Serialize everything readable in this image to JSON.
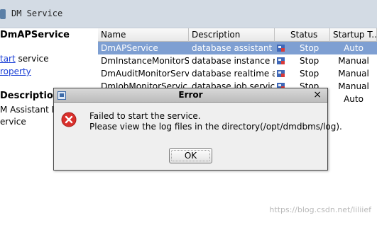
{
  "window": {
    "title": "DM Service"
  },
  "left_panel": {
    "service_name": "DmAPService",
    "links": [
      {
        "link": "tart",
        "suffix": " service"
      },
      {
        "link": "roperty",
        "suffix": ""
      }
    ],
    "description_label": "Description:",
    "description_lines": [
      "M Assistant P",
      "ervice"
    ]
  },
  "table": {
    "columns": [
      "Name",
      "Description",
      "Status",
      "Startup T..."
    ],
    "rows": [
      {
        "name": "DmAPService",
        "description": "database assistant p...",
        "status": "Stop",
        "startup": "Auto",
        "selected": true
      },
      {
        "name": "DmInstanceMonitorSe...",
        "description": "database instance m...",
        "status": "Stop",
        "startup": "Manual",
        "selected": false
      },
      {
        "name": "DmAuditMonitorServi...",
        "description": "database realtime a...",
        "status": "Stop",
        "startup": "Manual",
        "selected": false
      },
      {
        "name": "DmJobMonitorServic...",
        "description": "database job service...",
        "status": "Stop",
        "startup": "Manual",
        "selected": false
      },
      {
        "name": "",
        "description": "",
        "status": "",
        "startup": "Auto",
        "selected": false
      }
    ]
  },
  "dialog": {
    "title": "Error",
    "close_glyph": "×",
    "message_line1": "Failed to start the service.",
    "message_line2": "Please view the log files in the directory(/opt/dmdbms/log).",
    "ok_label": "OK"
  },
  "watermark": "https://blog.csdn.net/liliief",
  "colors": {
    "selection": "#7e9fd2",
    "link": "#1a3fd6",
    "error_icon": "#d9302c",
    "titlebar": "#d3dbe4"
  },
  "icons": {
    "status": "service-status-icon",
    "error": "error-icon",
    "dialog": "window-icon"
  }
}
